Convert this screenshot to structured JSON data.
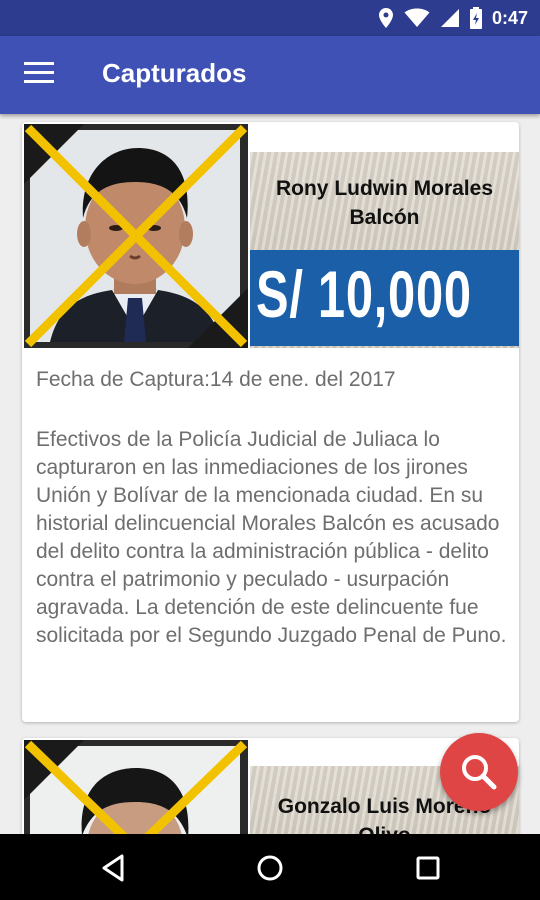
{
  "status_bar": {
    "time": "0:47",
    "icons": [
      "location-icon",
      "wifi-icon",
      "signal-icon",
      "battery-icon"
    ]
  },
  "app_bar": {
    "title": "Capturados",
    "menu_icon": "menu-icon"
  },
  "captures": [
    {
      "name": "Rony Ludwin Morales Balcón",
      "reward": "S/ 10,000",
      "capture_date": "Fecha de Captura:14 de ene. del 2017",
      "description": "Efectivos de la Policía Judicial de Juliaca lo capturaron en las inmediaciones de los jirones Unión y Bolívar de la mencionada ciudad. En su historial delincuencial Morales Balcón es acusado del delito contra la administración pública - delito contra el patrimonio y peculado - usurpación agravada. La detención de este delincuente fue solicitada por el Segundo Juzgado Penal de Puno."
    },
    {
      "name": "Gonzalo Luis Moreno Olivo"
    }
  ],
  "fab": {
    "icon": "search-icon"
  },
  "nav_bar": {
    "icons": [
      "back-icon",
      "home-icon",
      "recents-icon"
    ]
  },
  "colors": {
    "primary": "#3f51b5",
    "primary_dark": "#2d3c8e",
    "accent": "#e04545",
    "reward_bg": "#1a5fa8",
    "captured_cross": "#f2c200"
  }
}
